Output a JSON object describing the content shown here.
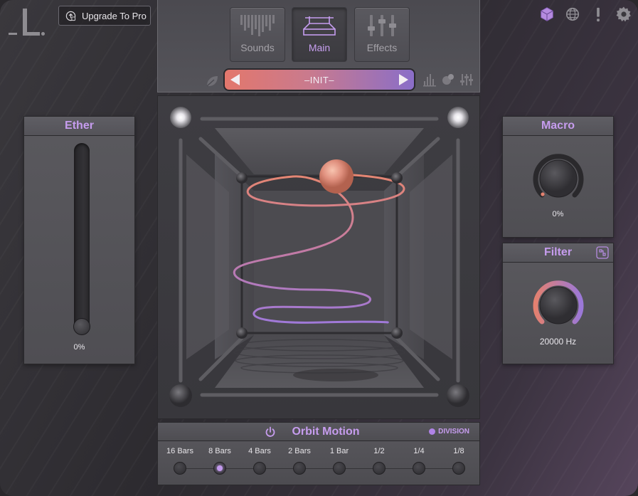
{
  "header": {
    "upgrade_label": "Upgrade To Pro",
    "icons": [
      "cube-icon",
      "globe-icon",
      "alert-icon",
      "gear-icon"
    ]
  },
  "nav": {
    "tabs": [
      {
        "label": "Sounds",
        "active": false
      },
      {
        "label": "Main",
        "active": true
      },
      {
        "label": "Effects",
        "active": false
      }
    ],
    "preset": "–INIT–"
  },
  "ether": {
    "title": "Ether",
    "value": "0%",
    "level": 0
  },
  "macro": {
    "title": "Macro",
    "value": "0%",
    "level": 0
  },
  "filter": {
    "title": "Filter",
    "value": "20000 Hz",
    "level": 1
  },
  "orbit": {
    "title": "Orbit Motion",
    "division_label": "DIVISION",
    "rates": [
      "16 Bars",
      "8 Bars",
      "4 Bars",
      "2 Bars",
      "1 Bar",
      "1/2",
      "1/4",
      "1/8"
    ],
    "selected_index": 1
  },
  "colors": {
    "accent": "#c69cee",
    "gradient_start": "#e3776c",
    "gradient_end": "#8a6ec8",
    "orb": "#e0907e"
  }
}
